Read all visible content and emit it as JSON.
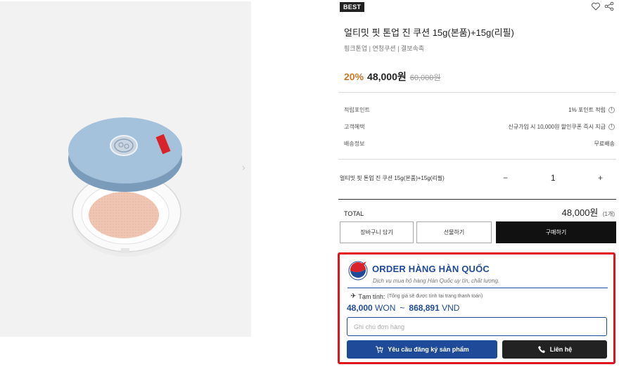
{
  "product": {
    "badge": "BEST",
    "title": "얼티밋 핏 톤업 진 쿠션 15g(본품)+15g(리필)",
    "subtitle": "핑크톤업 | 연청쿠션 | 결보속촉",
    "discount": "20%",
    "price": "48,000원",
    "original_price": "60,000원",
    "image_icon": "cushion-compact-image",
    "next_arrow": "›"
  },
  "details": [
    {
      "label": "적립포인트",
      "value": "1% 포인트 적립",
      "info": "!"
    },
    {
      "label": "고객혜택",
      "value": "신규가입 시 10,000원 할인쿠폰 즉시 지급",
      "info": "!"
    },
    {
      "label": "배송정보",
      "value": "무료배송",
      "info": ""
    }
  ],
  "option": {
    "name": "얼티밋 핏 톤업 진 쿠션 15g(본품)+15g(리필)",
    "minus": "−",
    "quantity": "1",
    "plus": "+"
  },
  "total": {
    "label": "TOTAL",
    "amount": "48,000원",
    "count": "(1개)"
  },
  "buttons": {
    "cart": "장바구니 담기",
    "gift": "선물하기",
    "buy": "구매하기"
  },
  "order_widget": {
    "title": "ORDER HÀNG HÀN QUỐC",
    "tagline": "Dịch vụ mua hộ hàng Hàn Quốc uy tín, chất lượng.",
    "estimate_label": "Tạm tính:",
    "estimate_note": "(Tổng giá sẽ được tính tại trang thanh toán)",
    "won_amount": "48,000",
    "won_unit": "WON",
    "approx": "~",
    "vnd_amount": "868,891",
    "vnd_unit": "VND",
    "note_placeholder": "Ghi chú đơn hàng",
    "request_label": "Yêu cầu đăng ký sản phẩm",
    "contact_label": "Liên hệ",
    "highlight_color": "#e0141a",
    "accent_color": "#1f4a9a"
  }
}
